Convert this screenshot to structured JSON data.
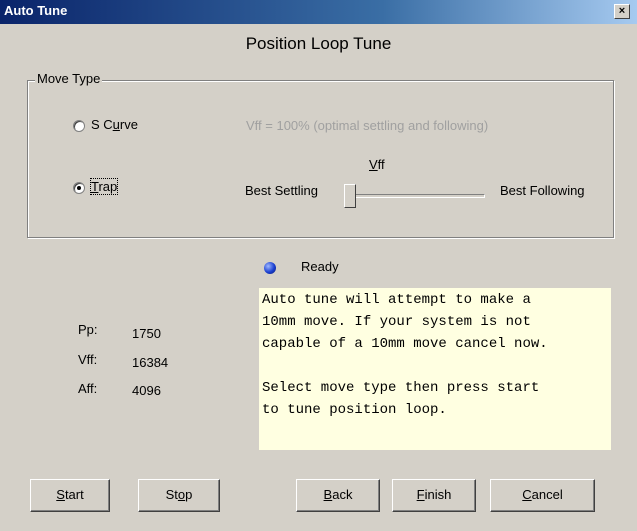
{
  "window": {
    "title": "Auto Tune",
    "close_glyph": "×",
    "heading": "Position Loop Tune"
  },
  "move_type": {
    "group_label": "Move Type",
    "options": [
      {
        "label_pre": "S C",
        "label_ul": "u",
        "label_post": "rve",
        "selected": false
      },
      {
        "label_pre": "",
        "label_ul": "T",
        "label_post": "rap",
        "selected": true
      }
    ],
    "scurve_note": "Vff = 100% (optimal settling and following)"
  },
  "vff_slider": {
    "label_ul": "V",
    "label_post": "ff",
    "left_label": "Best Settling",
    "right_label": "Best Following",
    "value_fraction": 0.0
  },
  "status": {
    "text": "Ready",
    "indicator_color": "#1a3fd0"
  },
  "gains": [
    {
      "name": "Pp:",
      "value": "1750"
    },
    {
      "name": "Vff:",
      "value": "16384"
    },
    {
      "name": "Aff:",
      "value": "4096"
    }
  ],
  "info_text": "Auto tune will attempt to make a\n10mm move. If your system is not\ncapable of a 10mm move cancel now.\n\nSelect move type then press start\nto tune position loop.",
  "buttons": {
    "start": {
      "pre": "",
      "ul": "S",
      "post": "tart"
    },
    "stop": {
      "pre": "St",
      "ul": "o",
      "post": "p"
    },
    "back": {
      "pre": "",
      "ul": "B",
      "post": "ack"
    },
    "finish": {
      "pre": "",
      "ul": "F",
      "post": "inish"
    },
    "cancel": {
      "pre": "",
      "ul": "C",
      "post": "ancel"
    }
  },
  "colors": {
    "title_bar": "#0a246a",
    "dialog_bg": "#d4d0c8",
    "info_bg": "#ffffe1"
  }
}
